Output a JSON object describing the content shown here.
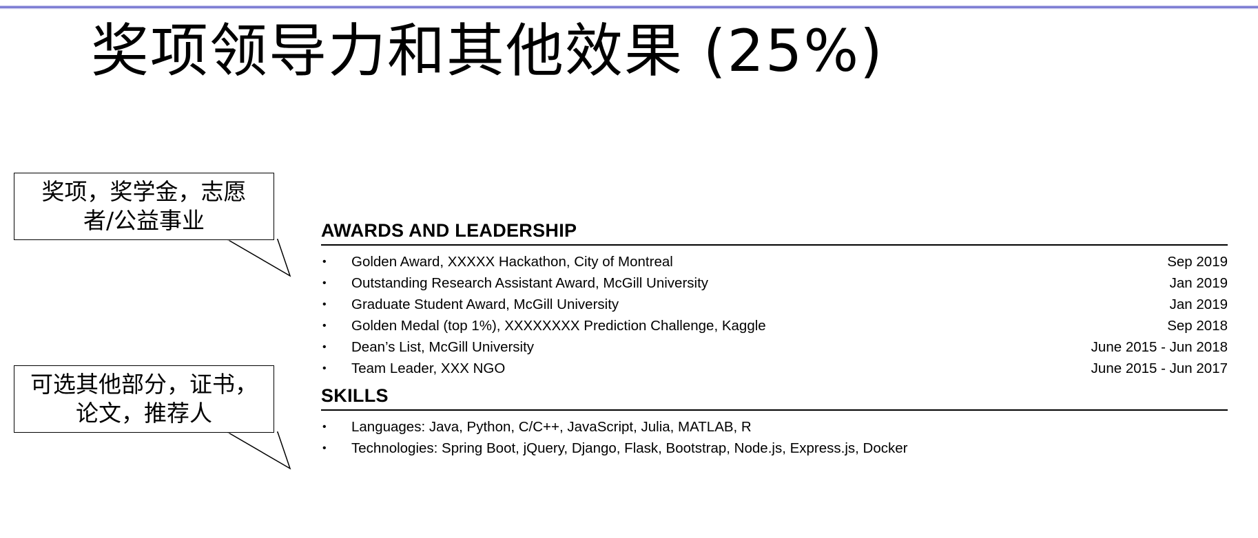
{
  "slide": {
    "title": "奖项领导力和其他效果 (25%)"
  },
  "callouts": [
    {
      "text_line1": "奖项，奖学金，志愿",
      "text_line2": "者/公益事业"
    },
    {
      "text_line1": "可选其他部分，证书，",
      "text_line2": "论文，推荐人"
    }
  ],
  "resume": {
    "awards": {
      "heading": "AWARDS AND LEADERSHIP",
      "bullet": "•",
      "items": [
        {
          "text": "Golden Award, XXXXX Hackathon, City of Montreal",
          "date": "Sep 2019"
        },
        {
          "text": "Outstanding Research Assistant Award, McGill University",
          "date": "Jan 2019"
        },
        {
          "text": "Graduate Student Award, McGill University",
          "date": "Jan 2019"
        },
        {
          "text": "Golden Medal (top 1%), XXXXXXXX Prediction Challenge, Kaggle",
          "date": "Sep 2018"
        },
        {
          "text": "Dean’s List, McGill University",
          "date": "June 2015 - Jun 2018"
        },
        {
          "text": "Team Leader, XXX NGO",
          "date": "June 2015 - Jun 2017"
        }
      ]
    },
    "skills": {
      "heading": "SKILLS",
      "bullet": "•",
      "items": [
        {
          "text": "Languages: Java, Python, C/C++, JavaScript, Julia, MATLAB, R"
        },
        {
          "text": "Technologies: Spring Boot, jQuery, Django, Flask, Bootstrap, Node.js, Express.js, Docker"
        }
      ]
    }
  }
}
